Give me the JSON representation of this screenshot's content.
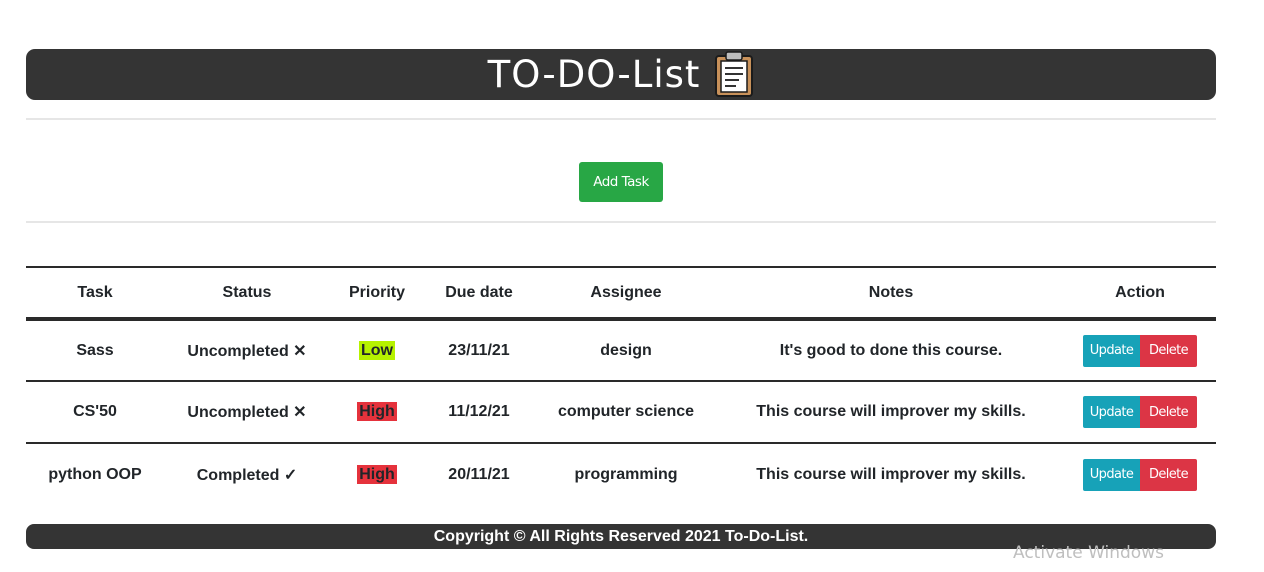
{
  "app": {
    "title": "TO-DO-List",
    "title_icon": "clipboard-icon"
  },
  "toolbar": {
    "add_task_label": "Add Task"
  },
  "table": {
    "columns": [
      "Task",
      "Status",
      "Priority",
      "Due date",
      "Assignee",
      "Notes",
      "Action"
    ],
    "rows": [
      {
        "task": "Sass",
        "status": "Uncompleted ✕",
        "priority": "Low",
        "due": "23/11/21",
        "assignee": "design",
        "notes": "It's good to done this course.",
        "update_label": "Update",
        "delete_label": "Delete"
      },
      {
        "task": "CS'50",
        "status": "Uncompleted ✕",
        "priority": "High",
        "due": "11/12/21",
        "assignee": "computer science",
        "notes": "This course will improver my skills.",
        "update_label": "Update",
        "delete_label": "Delete"
      },
      {
        "task": "python OOP",
        "status": "Completed ✓",
        "priority": "High",
        "due": "20/11/21",
        "assignee": "programming",
        "notes": "This course will improver my skills.",
        "update_label": "Update",
        "delete_label": "Delete"
      }
    ]
  },
  "footer": {
    "text": "Copyright © All Rights Reserved 2021 To-Do-List."
  },
  "os_overlay": {
    "watermark": "Activate Windows"
  },
  "colors": {
    "header_bg": "#343434",
    "add_button": "#28a745",
    "update_button": "#17a2b8",
    "delete_button": "#dc3545",
    "priority_low": "#b6f200",
    "priority_high": "#e5323c"
  }
}
